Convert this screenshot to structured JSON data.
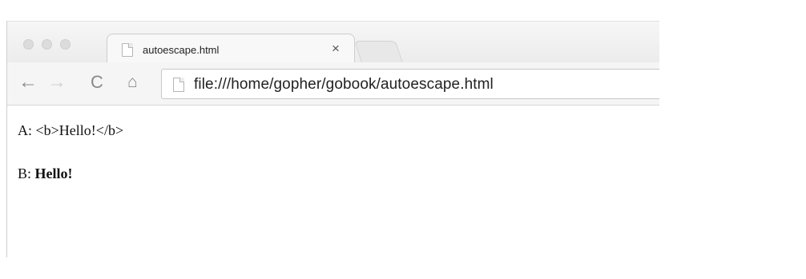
{
  "tab": {
    "title": "autoescape.html",
    "close_glyph": "×"
  },
  "toolbar": {
    "back_glyph": "←",
    "forward_glyph": "→",
    "reload_glyph": "C",
    "home_glyph": "⌂",
    "url": "file:///home/gopher/gobook/autoescape.html"
  },
  "content": {
    "line_a_prefix": "A: ",
    "line_a_text": "<b>Hello!</b>",
    "line_b_prefix": "B: ",
    "line_b_text": "Hello!"
  },
  "colors": {
    "page_bg": "#ffffff",
    "chrome_bg": "#f5f5f5",
    "text": "#111111"
  }
}
